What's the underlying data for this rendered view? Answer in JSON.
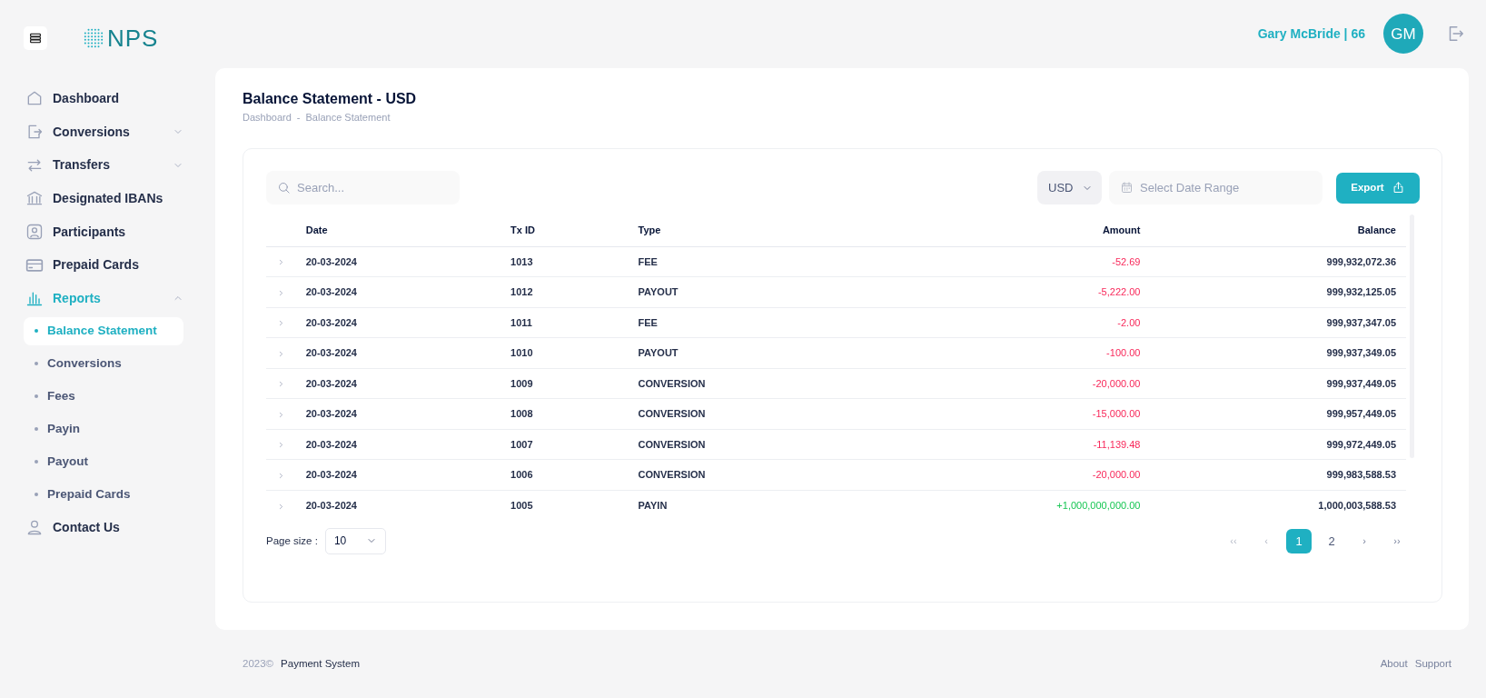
{
  "brand": {
    "logo_text": "NPS"
  },
  "user": {
    "name": "Gary McBride | 66",
    "initials": "GM"
  },
  "sidebar": {
    "items": [
      {
        "label": "Dashboard",
        "selected": false
      },
      {
        "label": "Conversions",
        "selected": false,
        "expanded": false
      },
      {
        "label": "Transfers",
        "selected": false,
        "expanded": false
      },
      {
        "label": "Designated IBANs",
        "selected": false
      },
      {
        "label": "Participants",
        "selected": false
      },
      {
        "label": "Prepaid Cards",
        "selected": false
      },
      {
        "label": "Reports",
        "selected": true,
        "expanded": true,
        "children": [
          {
            "label": "Balance Statement",
            "selected": true
          },
          {
            "label": "Conversions",
            "selected": false
          },
          {
            "label": "Fees",
            "selected": false
          },
          {
            "label": "Payin",
            "selected": false
          },
          {
            "label": "Payout",
            "selected": false
          },
          {
            "label": "Prepaid Cards",
            "selected": false
          }
        ]
      },
      {
        "label": "Contact Us",
        "selected": false
      }
    ]
  },
  "page": {
    "title": "Balance Statement - USD",
    "breadcrumb": [
      "Dashboard",
      "Balance Statement"
    ],
    "breadcrumb_separator": "-"
  },
  "toolbar": {
    "search": {
      "placeholder": "Search..."
    },
    "currency": "USD",
    "date_range": {
      "placeholder": "Select Date Range"
    },
    "export_button": "Export"
  },
  "table": {
    "columns": [
      "Date",
      "Tx ID",
      "Type",
      "Amount",
      "Balance"
    ],
    "rows": [
      {
        "date": "20-03-2024",
        "tx_id": "1013",
        "type": "FEE",
        "amount": "-52.69",
        "kind": "debit",
        "balance": "999,932,072.36"
      },
      {
        "date": "20-03-2024",
        "tx_id": "1012",
        "type": "PAYOUT",
        "amount": "-5,222.00",
        "kind": "debit",
        "balance": "999,932,125.05"
      },
      {
        "date": "20-03-2024",
        "tx_id": "1011",
        "type": "FEE",
        "amount": "-2.00",
        "kind": "debit",
        "balance": "999,937,347.05"
      },
      {
        "date": "20-03-2024",
        "tx_id": "1010",
        "type": "PAYOUT",
        "amount": "-100.00",
        "kind": "debit",
        "balance": "999,937,349.05"
      },
      {
        "date": "20-03-2024",
        "tx_id": "1009",
        "type": "CONVERSION",
        "amount": "-20,000.00",
        "kind": "debit",
        "balance": "999,937,449.05"
      },
      {
        "date": "20-03-2024",
        "tx_id": "1008",
        "type": "CONVERSION",
        "amount": "-15,000.00",
        "kind": "debit",
        "balance": "999,957,449.05"
      },
      {
        "date": "20-03-2024",
        "tx_id": "1007",
        "type": "CONVERSION",
        "amount": "-11,139.48",
        "kind": "debit",
        "balance": "999,972,449.05"
      },
      {
        "date": "20-03-2024",
        "tx_id": "1006",
        "type": "CONVERSION",
        "amount": "-20,000.00",
        "kind": "debit",
        "balance": "999,983,588.53"
      },
      {
        "date": "20-03-2024",
        "tx_id": "1005",
        "type": "PAYIN",
        "amount": "+1,000,000,000.00",
        "kind": "credit",
        "balance": "1,000,003,588.53"
      }
    ]
  },
  "pagination": {
    "page_size_label": "Page size :",
    "page_size": "10",
    "first": "‹‹",
    "prev": "‹",
    "pages": [
      {
        "label": "1",
        "selected": true
      },
      {
        "label": "2",
        "selected": false
      }
    ],
    "next": "›",
    "last": "››"
  },
  "footer": {
    "year": "2023©",
    "company": "Payment System",
    "links": [
      "About",
      "Support"
    ]
  }
}
